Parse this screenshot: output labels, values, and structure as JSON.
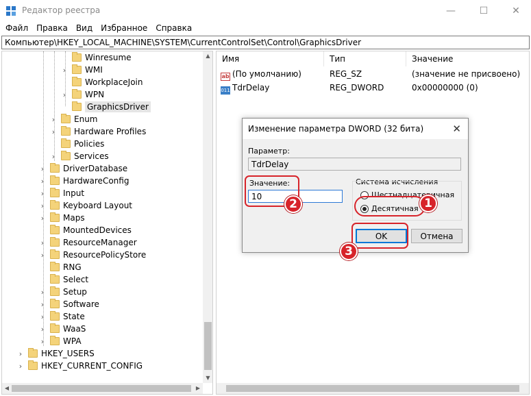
{
  "window": {
    "title": "Редактор реестра",
    "controls": {
      "minimize": "—",
      "maximize": "☐",
      "close": "✕"
    }
  },
  "menu": [
    "Файл",
    "Правка",
    "Вид",
    "Избранное",
    "Справка"
  ],
  "address": "Компьютер\\HKEY_LOCAL_MACHINE\\SYSTEM\\CurrentControlSet\\Control\\GraphicsDriver",
  "tree": [
    {
      "label": "Winresume",
      "level": 3,
      "expander": false
    },
    {
      "label": "WMI",
      "level": 3,
      "expander": true
    },
    {
      "label": "WorkplaceJoin",
      "level": 3,
      "expander": false
    },
    {
      "label": "WPN",
      "level": 3,
      "expander": true
    },
    {
      "label": "GraphicsDriver",
      "level": 3,
      "expander": false,
      "selected": true
    },
    {
      "label": "Enum",
      "level": 2,
      "expander": true
    },
    {
      "label": "Hardware Profiles",
      "level": 2,
      "expander": true
    },
    {
      "label": "Policies",
      "level": 2,
      "expander": false
    },
    {
      "label": "Services",
      "level": 2,
      "expander": true
    },
    {
      "label": "DriverDatabase",
      "level": 1,
      "expander": true
    },
    {
      "label": "HardwareConfig",
      "level": 1,
      "expander": true
    },
    {
      "label": "Input",
      "level": 1,
      "expander": true
    },
    {
      "label": "Keyboard Layout",
      "level": 1,
      "expander": true
    },
    {
      "label": "Maps",
      "level": 1,
      "expander": true
    },
    {
      "label": "MountedDevices",
      "level": 1,
      "expander": false
    },
    {
      "label": "ResourceManager",
      "level": 1,
      "expander": true
    },
    {
      "label": "ResourcePolicyStore",
      "level": 1,
      "expander": true
    },
    {
      "label": "RNG",
      "level": 1,
      "expander": false
    },
    {
      "label": "Select",
      "level": 1,
      "expander": false
    },
    {
      "label": "Setup",
      "level": 1,
      "expander": true
    },
    {
      "label": "Software",
      "level": 1,
      "expander": true
    },
    {
      "label": "State",
      "level": 1,
      "expander": true
    },
    {
      "label": "WaaS",
      "level": 1,
      "expander": true
    },
    {
      "label": "WPA",
      "level": 1,
      "expander": true
    },
    {
      "label": "HKEY_USERS",
      "level": 0,
      "expander": true
    },
    {
      "label": "HKEY_CURRENT_CONFIG",
      "level": 0,
      "expander": true
    }
  ],
  "list": {
    "columns": [
      "Имя",
      "Тип",
      "Значение"
    ],
    "rows": [
      {
        "icon": "string-value-icon",
        "icon_text": "ab",
        "name": "(По умолчанию)",
        "type": "REG_SZ",
        "value": "(значение не присвоено)"
      },
      {
        "icon": "binary-value-icon",
        "icon_text": "011",
        "name": "TdrDelay",
        "type": "REG_DWORD",
        "value": "0x00000000 (0)"
      }
    ]
  },
  "dialog": {
    "title": "Изменение параметра DWORD (32 бита)",
    "close": "✕",
    "param_label": "Параметр:",
    "param_value": "TdrDelay",
    "value_label": "Значение:",
    "value_input": "10",
    "base_group_label": "Система исчисления",
    "radio_hex": "Шестнадцатеричная",
    "radio_dec": "Десятичная",
    "selected_base": "Десятичная",
    "ok": "OK",
    "cancel": "Отмена"
  },
  "annotations": {
    "color": "#d7232a",
    "markers": [
      "1",
      "2",
      "3"
    ]
  }
}
